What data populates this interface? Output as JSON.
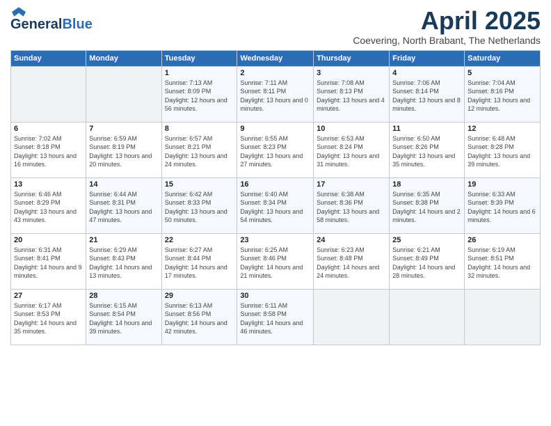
{
  "header": {
    "logo_general": "General",
    "logo_blue": "Blue",
    "month_title": "April 2025",
    "location": "Coevering, North Brabant, The Netherlands"
  },
  "weekdays": [
    "Sunday",
    "Monday",
    "Tuesday",
    "Wednesday",
    "Thursday",
    "Friday",
    "Saturday"
  ],
  "weeks": [
    [
      {
        "day": "",
        "sunrise": "",
        "sunset": "",
        "daylight": ""
      },
      {
        "day": "",
        "sunrise": "",
        "sunset": "",
        "daylight": ""
      },
      {
        "day": "1",
        "sunrise": "Sunrise: 7:13 AM",
        "sunset": "Sunset: 8:09 PM",
        "daylight": "Daylight: 12 hours and 56 minutes."
      },
      {
        "day": "2",
        "sunrise": "Sunrise: 7:11 AM",
        "sunset": "Sunset: 8:11 PM",
        "daylight": "Daylight: 13 hours and 0 minutes."
      },
      {
        "day": "3",
        "sunrise": "Sunrise: 7:08 AM",
        "sunset": "Sunset: 8:13 PM",
        "daylight": "Daylight: 13 hours and 4 minutes."
      },
      {
        "day": "4",
        "sunrise": "Sunrise: 7:06 AM",
        "sunset": "Sunset: 8:14 PM",
        "daylight": "Daylight: 13 hours and 8 minutes."
      },
      {
        "day": "5",
        "sunrise": "Sunrise: 7:04 AM",
        "sunset": "Sunset: 8:16 PM",
        "daylight": "Daylight: 13 hours and 12 minutes."
      }
    ],
    [
      {
        "day": "6",
        "sunrise": "Sunrise: 7:02 AM",
        "sunset": "Sunset: 8:18 PM",
        "daylight": "Daylight: 13 hours and 16 minutes."
      },
      {
        "day": "7",
        "sunrise": "Sunrise: 6:59 AM",
        "sunset": "Sunset: 8:19 PM",
        "daylight": "Daylight: 13 hours and 20 minutes."
      },
      {
        "day": "8",
        "sunrise": "Sunrise: 6:57 AM",
        "sunset": "Sunset: 8:21 PM",
        "daylight": "Daylight: 13 hours and 24 minutes."
      },
      {
        "day": "9",
        "sunrise": "Sunrise: 6:55 AM",
        "sunset": "Sunset: 8:23 PM",
        "daylight": "Daylight: 13 hours and 27 minutes."
      },
      {
        "day": "10",
        "sunrise": "Sunrise: 6:53 AM",
        "sunset": "Sunset: 8:24 PM",
        "daylight": "Daylight: 13 hours and 31 minutes."
      },
      {
        "day": "11",
        "sunrise": "Sunrise: 6:50 AM",
        "sunset": "Sunset: 8:26 PM",
        "daylight": "Daylight: 13 hours and 35 minutes."
      },
      {
        "day": "12",
        "sunrise": "Sunrise: 6:48 AM",
        "sunset": "Sunset: 8:28 PM",
        "daylight": "Daylight: 13 hours and 39 minutes."
      }
    ],
    [
      {
        "day": "13",
        "sunrise": "Sunrise: 6:46 AM",
        "sunset": "Sunset: 8:29 PM",
        "daylight": "Daylight: 13 hours and 43 minutes."
      },
      {
        "day": "14",
        "sunrise": "Sunrise: 6:44 AM",
        "sunset": "Sunset: 8:31 PM",
        "daylight": "Daylight: 13 hours and 47 minutes."
      },
      {
        "day": "15",
        "sunrise": "Sunrise: 6:42 AM",
        "sunset": "Sunset: 8:33 PM",
        "daylight": "Daylight: 13 hours and 50 minutes."
      },
      {
        "day": "16",
        "sunrise": "Sunrise: 6:40 AM",
        "sunset": "Sunset: 8:34 PM",
        "daylight": "Daylight: 13 hours and 54 minutes."
      },
      {
        "day": "17",
        "sunrise": "Sunrise: 6:38 AM",
        "sunset": "Sunset: 8:36 PM",
        "daylight": "Daylight: 13 hours and 58 minutes."
      },
      {
        "day": "18",
        "sunrise": "Sunrise: 6:35 AM",
        "sunset": "Sunset: 8:38 PM",
        "daylight": "Daylight: 14 hours and 2 minutes."
      },
      {
        "day": "19",
        "sunrise": "Sunrise: 6:33 AM",
        "sunset": "Sunset: 8:39 PM",
        "daylight": "Daylight: 14 hours and 6 minutes."
      }
    ],
    [
      {
        "day": "20",
        "sunrise": "Sunrise: 6:31 AM",
        "sunset": "Sunset: 8:41 PM",
        "daylight": "Daylight: 14 hours and 9 minutes."
      },
      {
        "day": "21",
        "sunrise": "Sunrise: 6:29 AM",
        "sunset": "Sunset: 8:43 PM",
        "daylight": "Daylight: 14 hours and 13 minutes."
      },
      {
        "day": "22",
        "sunrise": "Sunrise: 6:27 AM",
        "sunset": "Sunset: 8:44 PM",
        "daylight": "Daylight: 14 hours and 17 minutes."
      },
      {
        "day": "23",
        "sunrise": "Sunrise: 6:25 AM",
        "sunset": "Sunset: 8:46 PM",
        "daylight": "Daylight: 14 hours and 21 minutes."
      },
      {
        "day": "24",
        "sunrise": "Sunrise: 6:23 AM",
        "sunset": "Sunset: 8:48 PM",
        "daylight": "Daylight: 14 hours and 24 minutes."
      },
      {
        "day": "25",
        "sunrise": "Sunrise: 6:21 AM",
        "sunset": "Sunset: 8:49 PM",
        "daylight": "Daylight: 14 hours and 28 minutes."
      },
      {
        "day": "26",
        "sunrise": "Sunrise: 6:19 AM",
        "sunset": "Sunset: 8:51 PM",
        "daylight": "Daylight: 14 hours and 32 minutes."
      }
    ],
    [
      {
        "day": "27",
        "sunrise": "Sunrise: 6:17 AM",
        "sunset": "Sunset: 8:53 PM",
        "daylight": "Daylight: 14 hours and 35 minutes."
      },
      {
        "day": "28",
        "sunrise": "Sunrise: 6:15 AM",
        "sunset": "Sunset: 8:54 PM",
        "daylight": "Daylight: 14 hours and 39 minutes."
      },
      {
        "day": "29",
        "sunrise": "Sunrise: 6:13 AM",
        "sunset": "Sunset: 8:56 PM",
        "daylight": "Daylight: 14 hours and 42 minutes."
      },
      {
        "day": "30",
        "sunrise": "Sunrise: 6:11 AM",
        "sunset": "Sunset: 8:58 PM",
        "daylight": "Daylight: 14 hours and 46 minutes."
      },
      {
        "day": "",
        "sunrise": "",
        "sunset": "",
        "daylight": ""
      },
      {
        "day": "",
        "sunrise": "",
        "sunset": "",
        "daylight": ""
      },
      {
        "day": "",
        "sunrise": "",
        "sunset": "",
        "daylight": ""
      }
    ]
  ]
}
